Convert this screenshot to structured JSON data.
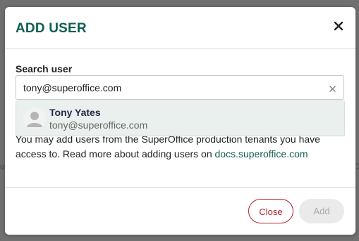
{
  "dialog": {
    "title": "ADD USER",
    "close_label": "✕"
  },
  "search": {
    "label": "Search user",
    "value": "tony@superoffice.com",
    "placeholder": ""
  },
  "suggestion": {
    "name": "Tony Yates",
    "email": "tony@superoffice.com"
  },
  "info": {
    "text": "You may add users from the SuperOffice production tenants you have access to. Read more about adding users on ",
    "link_text": "docs.superoffice.com"
  },
  "footer": {
    "close_button": "Close",
    "add_button": "Add"
  },
  "background": {
    "left_edge_text": "u",
    "right_edge_text": "C"
  },
  "colors": {
    "title": "#0d5e53",
    "link": "#0d5e53",
    "close_button": "#b21d2c",
    "suggestion_bg": "#e9f0ee"
  }
}
